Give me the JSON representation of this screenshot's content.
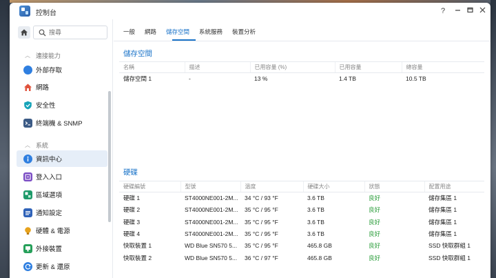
{
  "window": {
    "title": "控制台"
  },
  "search": {
    "placeholder": "搜尋"
  },
  "sidebar": {
    "groups": [
      {
        "label": "連接能力"
      },
      {
        "label": "系統"
      }
    ],
    "items": [
      {
        "label": "外部存取",
        "icon": "globe-icon",
        "color": "#2f7fe0"
      },
      {
        "label": "網路",
        "icon": "house-network-icon",
        "color": "#e0533d"
      },
      {
        "label": "安全性",
        "icon": "shield-icon",
        "color": "#16a3b8"
      },
      {
        "label": "終端機 & SNMP",
        "icon": "terminal-icon",
        "color": "#3b5a85"
      },
      {
        "label": "資訊中心",
        "icon": "info-icon",
        "color": "#2f7fe0"
      },
      {
        "label": "登入入口",
        "icon": "login-portal-icon",
        "color": "#7a4cc4"
      },
      {
        "label": "區域選項",
        "icon": "region-icon",
        "color": "#1e9a6a"
      },
      {
        "label": "通知設定",
        "icon": "notification-icon",
        "color": "#2f62b8"
      },
      {
        "label": "硬體 & 電源",
        "icon": "bulb-icon",
        "color": "#e7a21c"
      },
      {
        "label": "外接裝置",
        "icon": "external-device-icon",
        "color": "#26a05a"
      },
      {
        "label": "更新 & 還原",
        "icon": "update-icon",
        "color": "#2f7fe0"
      }
    ]
  },
  "tabs": [
    "一般",
    "網路",
    "儲存空間",
    "系統服務",
    "裝置分析"
  ],
  "storage": {
    "title": "儲存空間",
    "columns": [
      "名稱",
      "描述",
      "已用容量 (%)",
      "已用容量",
      "總容量"
    ],
    "rows": [
      [
        "儲存空間 1",
        "-",
        "13 %",
        "1.4 TB",
        "10.5 TB"
      ]
    ]
  },
  "disks": {
    "title": "硬碟",
    "columns": [
      "硬碟編號",
      "型號",
      "溫度",
      "硬碟大小",
      "狀態",
      "配置用途"
    ],
    "rows": [
      [
        "硬碟 1",
        "ST4000NE001-2M...",
        "34 °C / 93 °F",
        "3.6 TB",
        "良好",
        "儲存集區 1"
      ],
      [
        "硬碟 2",
        "ST4000NE001-2M...",
        "35 °C / 95 °F",
        "3.6 TB",
        "良好",
        "儲存集區 1"
      ],
      [
        "硬碟 3",
        "ST4000NE001-2M...",
        "35 °C / 95 °F",
        "3.6 TB",
        "良好",
        "儲存集區 1"
      ],
      [
        "硬碟 4",
        "ST4000NE001-2M...",
        "35 °C / 95 °F",
        "3.6 TB",
        "良好",
        "儲存集區 1"
      ],
      [
        "快取裝置 1",
        "WD Blue SN570 5...",
        "35 °C / 95 °F",
        "465.8 GB",
        "良好",
        "SSD 快取群組 1"
      ],
      [
        "快取裝置 2",
        "WD Blue SN570 5...",
        "36 °C / 97 °F",
        "465.8 GB",
        "良好",
        "SSD 快取群組 1"
      ]
    ]
  },
  "colors": {
    "accent": "#1a73c8",
    "status_good": "#2a9d3a"
  }
}
